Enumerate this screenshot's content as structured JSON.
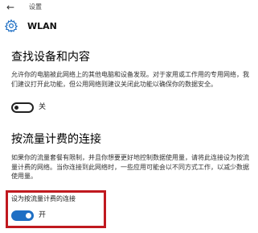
{
  "titlebar": {
    "back_icon": "back-arrow-icon",
    "title": "设置"
  },
  "header": {
    "icon": "gear-icon",
    "title": "WLAN"
  },
  "find_devices": {
    "title": "查找设备和内容",
    "description": "允许你的电脑被此网络上的其他电脑和设备发现。对于家用或工作用的专用网络，我们建议打开此功能，但公用网络则建议关闭此功能以确保你的数据安全。",
    "toggle_state": "关",
    "toggle_on": false
  },
  "metered": {
    "title": "按流量计费的连接",
    "description": "如果你的流量套餐有限制，并且你想要更好地控制数据使用量，请将此连接设为按流量计费的网络。当你连接到此网络时，一些应用可能会以不同方式工作，以减少数据使用量。",
    "toggle_label": "设为按流量计费的连接",
    "toggle_state": "开",
    "toggle_on": true
  },
  "colors": {
    "toggle_on": "#1f6fc4",
    "highlight": "#c0191f",
    "accent_icon": "#1f6fc4"
  }
}
